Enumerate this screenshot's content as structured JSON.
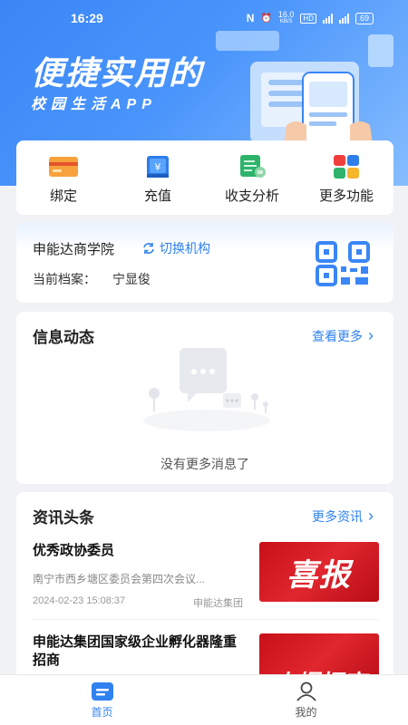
{
  "status_bar": {
    "time": "16:29",
    "net_speed": "16.0",
    "net_unit": "KB/S",
    "hd": "HD",
    "signal": "5G",
    "battery": "69"
  },
  "hero": {
    "title": "便捷实用的",
    "subtitle": "校园生活APP"
  },
  "quick_actions": [
    {
      "label": "绑定",
      "icon": "card-icon"
    },
    {
      "label": "充值",
      "icon": "yen-book-icon"
    },
    {
      "label": "收支分析",
      "icon": "statement-icon"
    },
    {
      "label": "更多功能",
      "icon": "grid-apps-icon"
    }
  ],
  "org": {
    "name": "申能达商学院",
    "switch_label": "切换机构",
    "profile_label": "当前档案：",
    "profile_value": "宁显俊"
  },
  "info_section": {
    "title": "信息动态",
    "more": "查看更多",
    "empty_text": "没有更多消息了"
  },
  "news_section": {
    "title": "资讯头条",
    "more": "更多资讯",
    "items": [
      {
        "title": "优秀政协委员",
        "summary": "南宁市西乡塘区委员会第四次会议...",
        "time": "2024-02-23 15:08:37",
        "source": "申能达集团",
        "thumb_text": "喜报"
      },
      {
        "title": "申能达集团国家级企业孵化器隆重招商",
        "summary": "",
        "time": "",
        "source": "",
        "thumb_text": "火爆招商"
      }
    ]
  },
  "tabbar": {
    "items": [
      {
        "label": "首页",
        "active": true
      },
      {
        "label": "我的",
        "active": false
      }
    ]
  },
  "colors": {
    "brand": "#2f82f0",
    "hero_start": "#3a86f6",
    "hero_end": "#86bdfe",
    "news_red": "#d3141d"
  }
}
